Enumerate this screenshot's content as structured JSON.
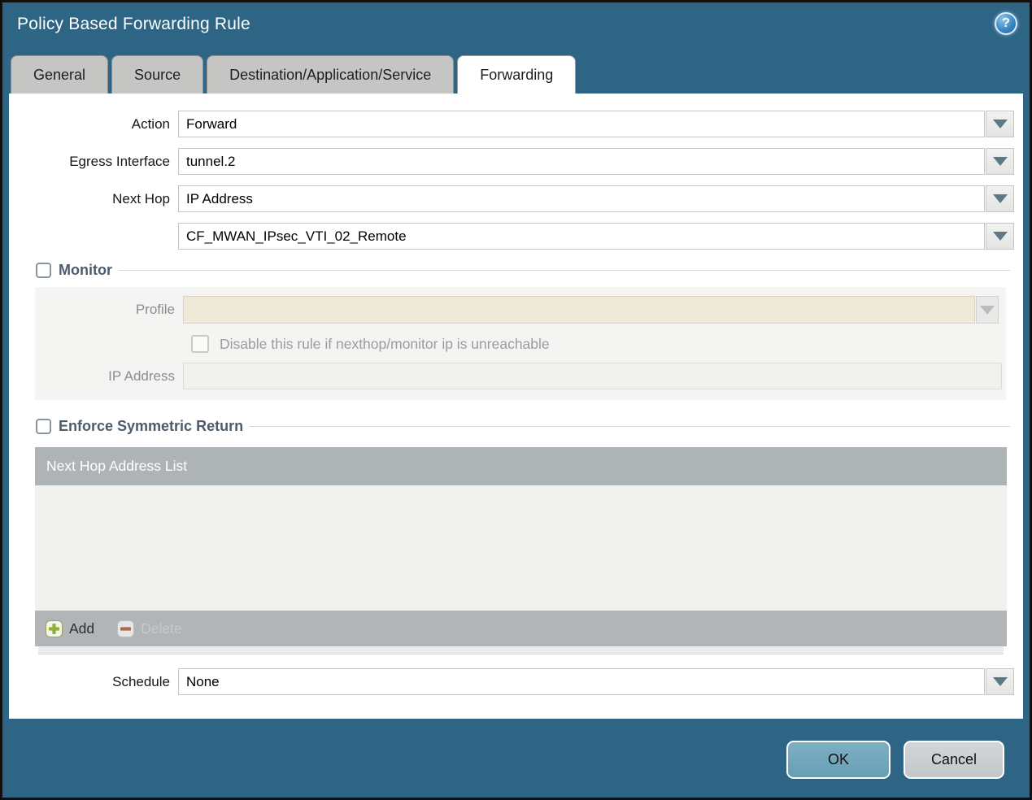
{
  "window": {
    "title": "Policy Based Forwarding Rule",
    "help_icon_glyph": "?"
  },
  "tabs": [
    {
      "label": "General",
      "active": false
    },
    {
      "label": "Source",
      "active": false
    },
    {
      "label": "Destination/Application/Service",
      "active": false
    },
    {
      "label": "Forwarding",
      "active": true
    }
  ],
  "form": {
    "action": {
      "label": "Action",
      "value": "Forward"
    },
    "egress_interface": {
      "label": "Egress Interface",
      "value": "tunnel.2"
    },
    "next_hop": {
      "label": "Next Hop",
      "value": "IP Address"
    },
    "next_hop_address": {
      "value": "CF_MWAN_IPsec_VTI_02_Remote"
    },
    "schedule": {
      "label": "Schedule",
      "value": "None"
    }
  },
  "monitor": {
    "legend": "Monitor",
    "checked": false,
    "profile": {
      "label": "Profile",
      "value": ""
    },
    "disable_checkbox": {
      "label": "Disable this rule if nexthop/monitor ip is unreachable",
      "checked": false
    },
    "ip_address": {
      "label": "IP Address",
      "value": ""
    }
  },
  "enforce_symmetric_return": {
    "legend": "Enforce Symmetric Return",
    "checked": false,
    "table": {
      "header": "Next Hop Address List",
      "rows": []
    },
    "buttons": {
      "add": "Add",
      "delete": "Delete",
      "delete_enabled": false
    }
  },
  "footer": {
    "ok": "OK",
    "cancel": "Cancel"
  },
  "colors": {
    "dialog_teal": "#2e6585",
    "tab_inactive_bg": "#c5c6c4",
    "tab_active_bg": "#ffffff",
    "group_legend_text": "#4b5c6c",
    "profile_disabled_bg": "#efe9d8",
    "table_header_bg": "#aeb3b6",
    "table_footer_bg": "#b1b5b8",
    "ok_button_bg": "#6fa4ba",
    "cancel_button_bg": "#caced1",
    "add_icon_green": "#8fae3a",
    "delete_icon_red": "#b2674a",
    "dropdown_arrow": "#5e7888"
  }
}
